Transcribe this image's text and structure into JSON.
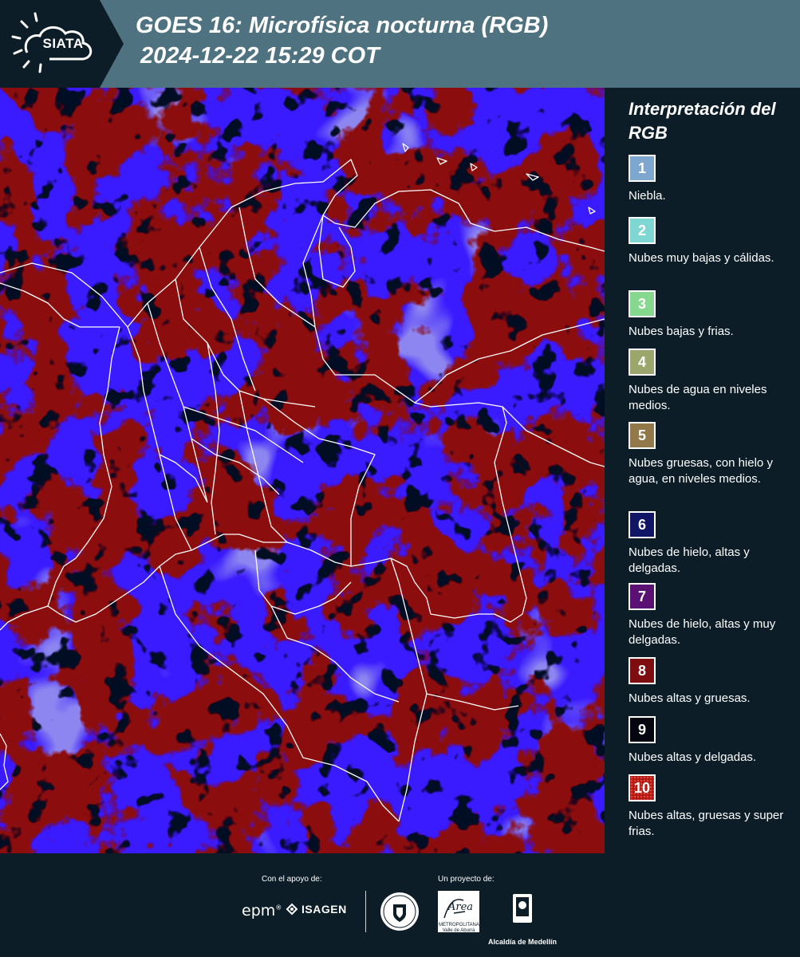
{
  "header": {
    "logo_text": "SIATA",
    "title_line1": "GOES 16: Microfísica nocturna (RGB)",
    "title_line2": "2024-12-22 15:29 COT"
  },
  "map": {
    "description_icon": "satellite-image",
    "colors": {
      "red": "#8c0a10",
      "blue": "#3a1aff",
      "black": "#060820",
      "border": "#ffffff"
    }
  },
  "legend": {
    "title": "Interpretación del RGB",
    "items": [
      {
        "number": "1",
        "color": "#7ea7cf",
        "text": "Niebla."
      },
      {
        "number": "2",
        "color": "#7fd7d3",
        "text": "Nubes muy bajas y cálidas."
      },
      {
        "number": "3",
        "color": "#85d88e",
        "text": "Nubes bajas y frias."
      },
      {
        "number": "4",
        "color": "#9aa66b",
        "text": "Nubes de agua en niveles medios."
      },
      {
        "number": "5",
        "color": "#93784a",
        "text": "Nubes gruesas, con hielo y agua, en niveles medios."
      },
      {
        "number": "6",
        "color": "#111566",
        "text": "Nubes de hielo, altas y delgadas."
      },
      {
        "number": "7",
        "color": "#5b1073",
        "text": "Nubes de hielo, altas y muy delgadas."
      },
      {
        "number": "8",
        "color": "#7e0d0f",
        "text": "Nubes altas y gruesas."
      },
      {
        "number": "9",
        "color": "#05050f",
        "text": "Nubes altas y delgadas."
      },
      {
        "number": "10",
        "color": "#b11a14",
        "text": "Nubes altas, gruesas y super frias."
      }
    ]
  },
  "footer": {
    "support_label": "Con el apoyo de:",
    "project_label": "Un proyecto de:",
    "epm": "epm",
    "epm_mark": "®",
    "isagen": "ISAGEN",
    "area_metro": "METROPOLITANA Valle de Aburrá",
    "area_script": "Área",
    "alcaldia": "Alcaldía de Medellín"
  }
}
